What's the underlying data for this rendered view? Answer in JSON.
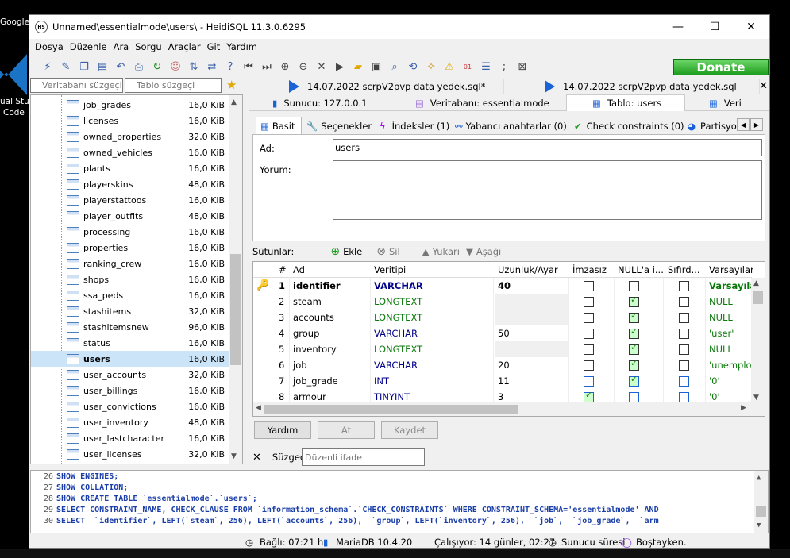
{
  "desktop": {
    "chrome_label": "Google Chrom",
    "vs_label1": "ual Stu",
    "vs_label2": "Code"
  },
  "window": {
    "title": "Unnamed\\essentialmode\\users\\ - HeidiSQL 11.3.0.6295",
    "app_icon_text": "HS"
  },
  "menu": [
    "Dosya",
    "Düzenle",
    "Ara",
    "Sorgu",
    "Araçlar",
    "Git",
    "Yardım"
  ],
  "toolbar": {
    "donate": "Donate"
  },
  "filters": {
    "db_placeholder": "Veritabanı süzgeçi",
    "table_placeholder": "Tablo süzgeçi"
  },
  "tree": [
    {
      "name": "job_grades",
      "size": "16,0 KiB"
    },
    {
      "name": "licenses",
      "size": "16,0 KiB"
    },
    {
      "name": "owned_properties",
      "size": "32,0 KiB"
    },
    {
      "name": "owned_vehicles",
      "size": "16,0 KiB"
    },
    {
      "name": "plants",
      "size": "16,0 KiB"
    },
    {
      "name": "playerskins",
      "size": "48,0 KiB"
    },
    {
      "name": "playerstattoos",
      "size": "16,0 KiB"
    },
    {
      "name": "player_outfits",
      "size": "48,0 KiB"
    },
    {
      "name": "processing",
      "size": "16,0 KiB"
    },
    {
      "name": "properties",
      "size": "16,0 KiB"
    },
    {
      "name": "ranking_crew",
      "size": "16,0 KiB"
    },
    {
      "name": "shops",
      "size": "16,0 KiB"
    },
    {
      "name": "ssa_peds",
      "size": "16,0 KiB"
    },
    {
      "name": "stashitems",
      "size": "32,0 KiB"
    },
    {
      "name": "stashitemsnew",
      "size": "96,0 KiB"
    },
    {
      "name": "status",
      "size": "16,0 KiB"
    },
    {
      "name": "users",
      "size": "16,0 KiB"
    },
    {
      "name": "user_accounts",
      "size": "32,0 KiB"
    },
    {
      "name": "user_billings",
      "size": "16,0 KiB"
    },
    {
      "name": "user_convictions",
      "size": "16,0 KiB"
    },
    {
      "name": "user_inventory",
      "size": "48,0 KiB"
    },
    {
      "name": "user_lastcharacter",
      "size": "16,0 KiB"
    },
    {
      "name": "user_licenses",
      "size": "32,0 KiB"
    }
  ],
  "query_tabs": [
    "14.07.2022 scrpV2pvp data yedek.sql*",
    "14.07.2022 scrpV2pvp data yedek.sql"
  ],
  "main_tabs": {
    "server": "Sunucu: 127.0.0.1",
    "database": "Veritabanı: essentialmode",
    "table": "Tablo: users",
    "data": "Veri"
  },
  "sub_tabs": {
    "basic": "Basit",
    "options": "Seçenekler",
    "indexes": "İndeksler (1)",
    "foreign": "Yabancı anahtarlar (0)",
    "check": "Check constraints (0)",
    "partitions": "Partisyo"
  },
  "basic": {
    "name_label": "Ad:",
    "name_value": "users",
    "comment_label": "Yorum:"
  },
  "columns_bar": {
    "label": "Sütunlar:",
    "add": "Ekle",
    "delete": "Sil",
    "up": "Yukarı",
    "down": "Aşağı"
  },
  "grid": {
    "headers": [
      "#",
      "Ad",
      "Veritipi",
      "Uzunluk/Ayar",
      "İmzasız",
      "NULL'a i...",
      "Sıfırd...",
      "Varsayılan"
    ],
    "rows": [
      {
        "n": "1",
        "name": "identifier",
        "type": "VARCHAR",
        "len": "40",
        "unsigned": false,
        "nullable": false,
        "zerofill": false,
        "def": "Varsayılan",
        "key": true
      },
      {
        "n": "2",
        "name": "steam",
        "type": "LONGTEXT",
        "len": "",
        "unsigned": false,
        "nullable": true,
        "zerofill": false,
        "def": "NULL"
      },
      {
        "n": "3",
        "name": "accounts",
        "type": "LONGTEXT",
        "len": "",
        "unsigned": false,
        "nullable": true,
        "zerofill": false,
        "def": "NULL"
      },
      {
        "n": "4",
        "name": "group",
        "type": "VARCHAR",
        "len": "50",
        "unsigned": false,
        "nullable": true,
        "zerofill": false,
        "def": "'user'"
      },
      {
        "n": "5",
        "name": "inventory",
        "type": "LONGTEXT",
        "len": "",
        "unsigned": false,
        "nullable": true,
        "zerofill": false,
        "def": "NULL"
      },
      {
        "n": "6",
        "name": "job",
        "type": "VARCHAR",
        "len": "20",
        "unsigned": false,
        "nullable": true,
        "zerofill": false,
        "def": "'unemplo"
      },
      {
        "n": "7",
        "name": "job_grade",
        "type": "INT",
        "len": "11",
        "unsigned": false,
        "nullable": true,
        "zerofill": false,
        "def": "'0'"
      },
      {
        "n": "8",
        "name": "armour",
        "type": "TINYINT",
        "len": "3",
        "unsigned": true,
        "nullable": false,
        "zerofill": false,
        "def": "'0'"
      }
    ]
  },
  "buttons": {
    "help": "Yardım",
    "discard": "At",
    "save": "Kaydet"
  },
  "filter": {
    "label": "Süzgeç",
    "placeholder": "Düzenli ifade"
  },
  "sql_lines": [
    {
      "n": "26",
      "code": "SHOW ENGINES;"
    },
    {
      "n": "27",
      "code": "SHOW COLLATION;"
    },
    {
      "n": "28",
      "code": "SHOW CREATE TABLE `essentialmode`.`users`;"
    },
    {
      "n": "29",
      "code": "SELECT CONSTRAINT_NAME, CHECK_CLAUSE FROM `information_schema`.`CHECK_CONSTRAINTS` WHERE CONSTRAINT_SCHEMA='essentialmode' AND"
    },
    {
      "n": "30",
      "code": "SELECT  `identifier`, LEFT(`steam`, 256), LEFT(`accounts`, 256),  `group`, LEFT(`inventory`, 256),  `job`,  `job_grade`,  `arm"
    }
  ],
  "status": {
    "connected": "Bağlı: 07:21 h",
    "server": "MariaDB 10.4.20",
    "uptime": "Çalışıyor: 14 günler, 02:27",
    "server_time": "Sunucu süresi",
    "idle": "Boştayken."
  }
}
